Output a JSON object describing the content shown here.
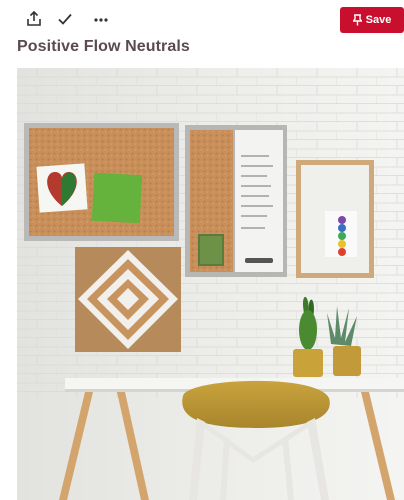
{
  "toolbar": {
    "share_icon": "share-icon",
    "check_icon": "check-icon",
    "more_icon": "more-icon",
    "save_icon": "pin-icon",
    "save_label": "Save",
    "save_color": "#c8102e"
  },
  "pin": {
    "title": "Positive Flow Neutrals"
  },
  "image": {
    "description_icons": [
      "corkboard",
      "whiteboard",
      "plant",
      "chair",
      "desk"
    ]
  }
}
